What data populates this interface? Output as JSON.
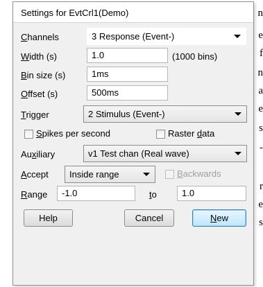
{
  "background_text": {
    "lines": [
      "n",
      "e",
      "f",
      "n",
      "a",
      "e",
      "s",
      "-",
      "",
      "r",
      "e",
      "s"
    ]
  },
  "dialog": {
    "title": "Settings for EvtCrl1(Demo)"
  },
  "channels": {
    "label_u": "C",
    "label_rest": "hannels",
    "value": "3 Response (Event-)"
  },
  "width": {
    "label_u": "W",
    "label_rest": "idth (s)",
    "value": "1.0",
    "bins_note": "(1000 bins)"
  },
  "bin_size": {
    "label_u": "B",
    "label_rest": "in size (s)",
    "value": "1ms"
  },
  "offset": {
    "label_u": "O",
    "label_rest": "ffset (s)",
    "value": "500ms"
  },
  "trigger": {
    "label_u": "T",
    "label_rest": "rigger",
    "value": "2 Stimulus (Event-)"
  },
  "spikes_per_second": {
    "label_u": "S",
    "label_rest": "pikes per second",
    "checked": false
  },
  "raster_data": {
    "label_pre": "Raster ",
    "label_u": "d",
    "label_rest": "ata",
    "checked": false
  },
  "auxiliary": {
    "label_pre": "Au",
    "label_u": "x",
    "label_rest": "iliary",
    "value": "v1 Test chan (Real wave)"
  },
  "accept": {
    "label_u": "A",
    "label_rest": "ccept",
    "value": "Inside range"
  },
  "backwards": {
    "label_u": "B",
    "label_rest": "ackwards",
    "checked": false,
    "enabled": false
  },
  "range": {
    "label_u": "R",
    "label_rest": "ange",
    "from_value": "-1.0",
    "to_label_u": "t",
    "to_label_rest": "o",
    "to_value": "1.0"
  },
  "buttons": {
    "help": "Help",
    "cancel": "Cancel",
    "new_u": "N",
    "new_rest": "ew"
  },
  "colors": {
    "dialog_bg": "#f0f0f0",
    "default_button_border": "#3c7fb1"
  }
}
